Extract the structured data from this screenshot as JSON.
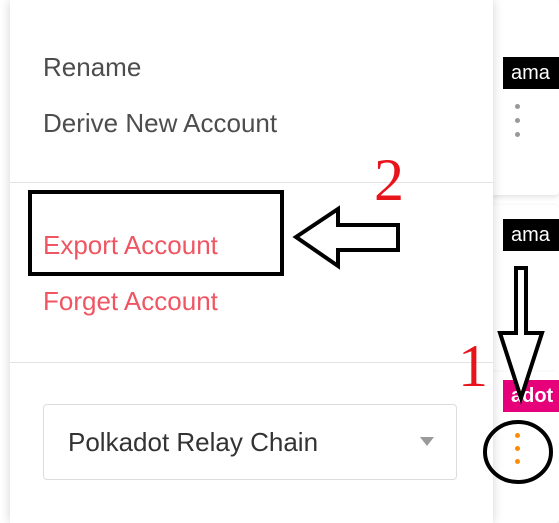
{
  "menu": {
    "rename_label": "Rename",
    "derive_label": "Derive New Account",
    "export_label": "Export Account",
    "forget_label": "Forget Account"
  },
  "network_select": {
    "value": "Polkadot Relay Chain"
  },
  "background_accounts": {
    "tag_1": "ama",
    "tag_2": "ama",
    "tag_3": "adot"
  },
  "annotations": {
    "step_1": "1",
    "step_2": "2"
  },
  "colors": {
    "danger_text": "#f05562",
    "polkadot_pink": "#e6007a",
    "annotation_red": "#e8141c",
    "kebab_active": "#ff8c00"
  },
  "icons": {
    "menu_button": "kebab-vertical-icon",
    "dropdown": "caret-down-icon",
    "pointer": "outline-arrow-icon"
  }
}
